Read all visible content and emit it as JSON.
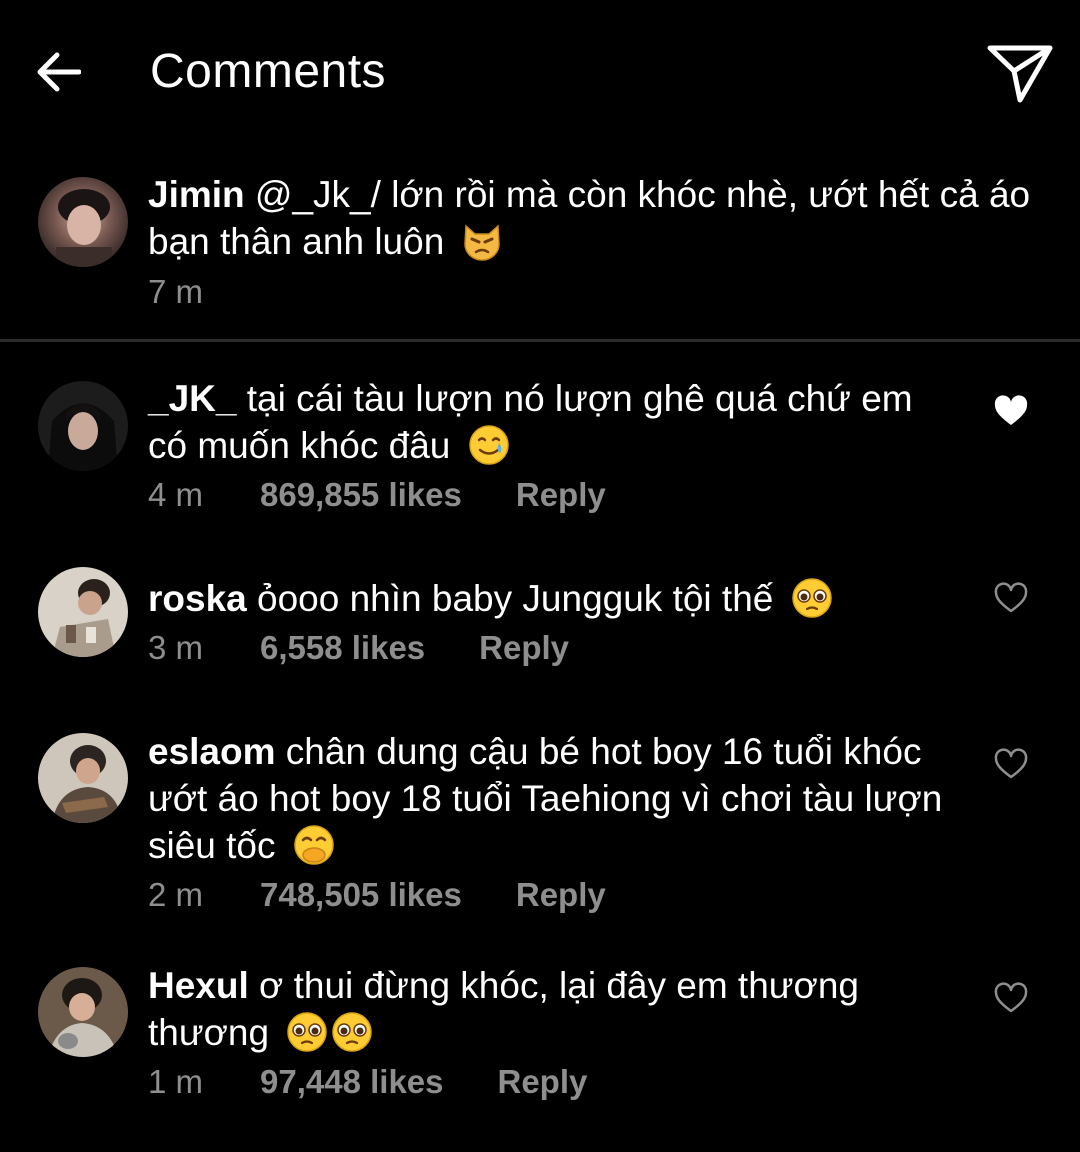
{
  "header": {
    "title": "Comments",
    "back_icon": "arrow-left-icon",
    "share_icon": "paper-plane-icon"
  },
  "caption": {
    "username": "Jimin",
    "text": " @_Jk_/ lớn rồi mà còn khóc nhè, ướt hết cả áo bạn thân anh luôn",
    "emoji": "pouting-cat-emoji",
    "time": "7 m"
  },
  "comments": [
    {
      "username": "_JK_",
      "text": " tại cái tàu lượn nó lượn ghê quá chứ em có muốn khóc đâu",
      "emoji": "smiling-face-with-tear-emoji",
      "time": "4 m",
      "likes": "869,855 likes",
      "reply": "Reply",
      "liked": true
    },
    {
      "username": "roska",
      "text": " ỏooo nhìn baby Jungguk tội thế",
      "emoji": "pleading-face-emoji",
      "time": "3 m",
      "likes": "6,558 likes",
      "reply": "Reply",
      "liked": false
    },
    {
      "username": "eslaom",
      "text": " chân dung cậu bé hot boy 16 tuổi khóc ướt áo hot boy 18 tuổi Taehiong vì chơi tàu lượn siêu tốc",
      "emoji": "face-with-hand-over-mouth-emoji",
      "time": "2 m",
      "likes": "748,505 likes",
      "reply": "Reply",
      "liked": false
    },
    {
      "username": "Hexul",
      "text": " ơ thui đừng khóc, lại đây em thương thương",
      "emoji": "pleading-face-emoji x2",
      "time": "1 m",
      "likes": "97,448 likes",
      "reply": "Reply",
      "liked": false
    }
  ],
  "colors": {
    "background": "#000000",
    "text": "#ffffff",
    "secondary": "#8e8e8e",
    "divider": "#2b2b2b"
  }
}
